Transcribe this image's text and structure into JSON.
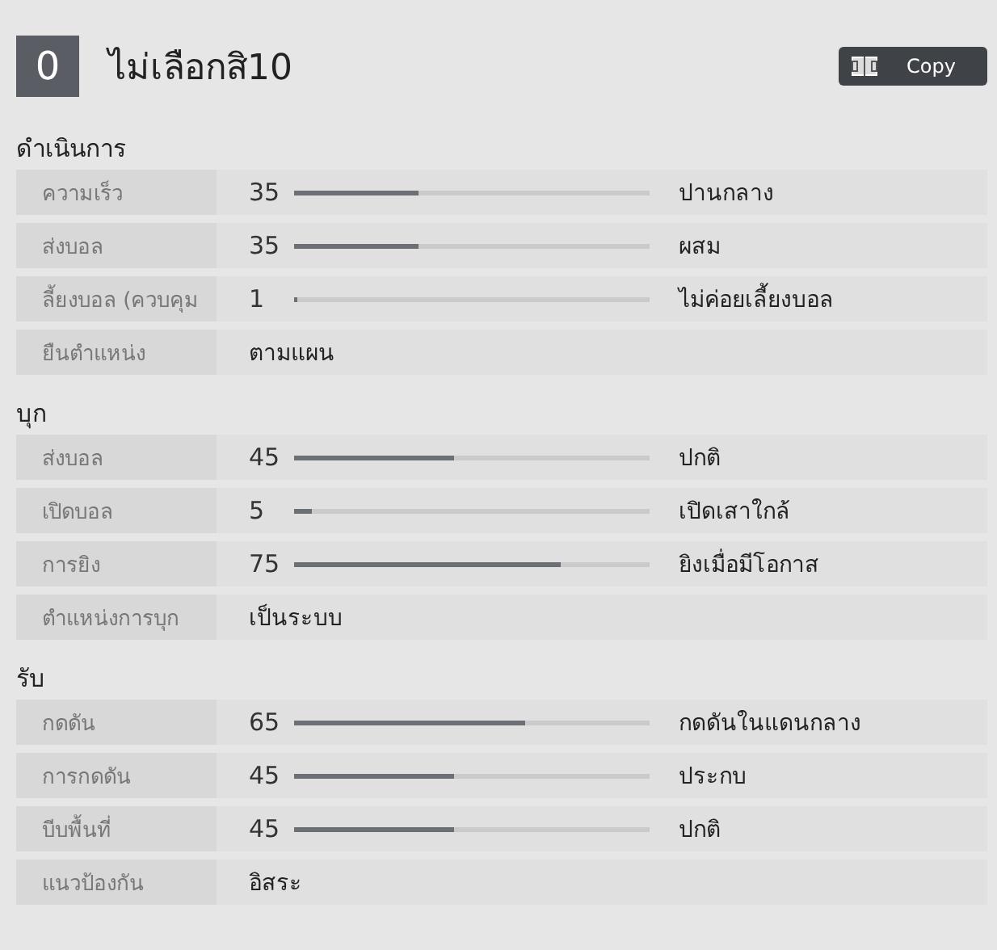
{
  "header": {
    "number": "0",
    "title": "ไม่เลือกสิ10",
    "copy_button": "Copy"
  },
  "sections": [
    {
      "title": "ดำเนินการ",
      "rows": [
        {
          "kind": "slider",
          "label": "ความเร็ว",
          "value": "35",
          "level": 0.35,
          "setting": "ปานกลาง"
        },
        {
          "kind": "slider",
          "label": "ส่งบอล",
          "value": "35",
          "level": 0.35,
          "setting": "ผสม"
        },
        {
          "kind": "slider",
          "label": "ลี้ยงบอล (ควบคุม",
          "value": "1",
          "level": 0.01,
          "setting": "ไม่ค่อยเลี้ยงบอล"
        },
        {
          "kind": "text",
          "label": "ยืนตำแหน่ง",
          "setting": "ตามแผน"
        }
      ]
    },
    {
      "title": "บุก",
      "rows": [
        {
          "kind": "slider",
          "label": "ส่งบอล",
          "value": "45",
          "level": 0.45,
          "setting": "ปกติ"
        },
        {
          "kind": "slider",
          "label": "เปิดบอล",
          "value": "5",
          "level": 0.05,
          "setting": "เปิดเสาใกล้"
        },
        {
          "kind": "slider",
          "label": "การยิง",
          "value": "75",
          "level": 0.75,
          "setting": "ยิงเมื่อมีโอกาส"
        },
        {
          "kind": "text",
          "label": "ตำแหน่งการบุก",
          "setting": "เป็นระบบ"
        }
      ]
    },
    {
      "title": "รับ",
      "rows": [
        {
          "kind": "slider",
          "label": "กดดัน",
          "value": "65",
          "level": 0.65,
          "setting": "กดดันในแดนกลาง"
        },
        {
          "kind": "slider",
          "label": "การกดดัน",
          "value": "45",
          "level": 0.45,
          "setting": "ประกบ"
        },
        {
          "kind": "slider",
          "label": "บีบพื้นที่",
          "value": "45",
          "level": 0.45,
          "setting": "ปกติ"
        },
        {
          "kind": "text",
          "label": "แนวป้องกัน",
          "setting": "อิสระ"
        }
      ]
    }
  ]
}
